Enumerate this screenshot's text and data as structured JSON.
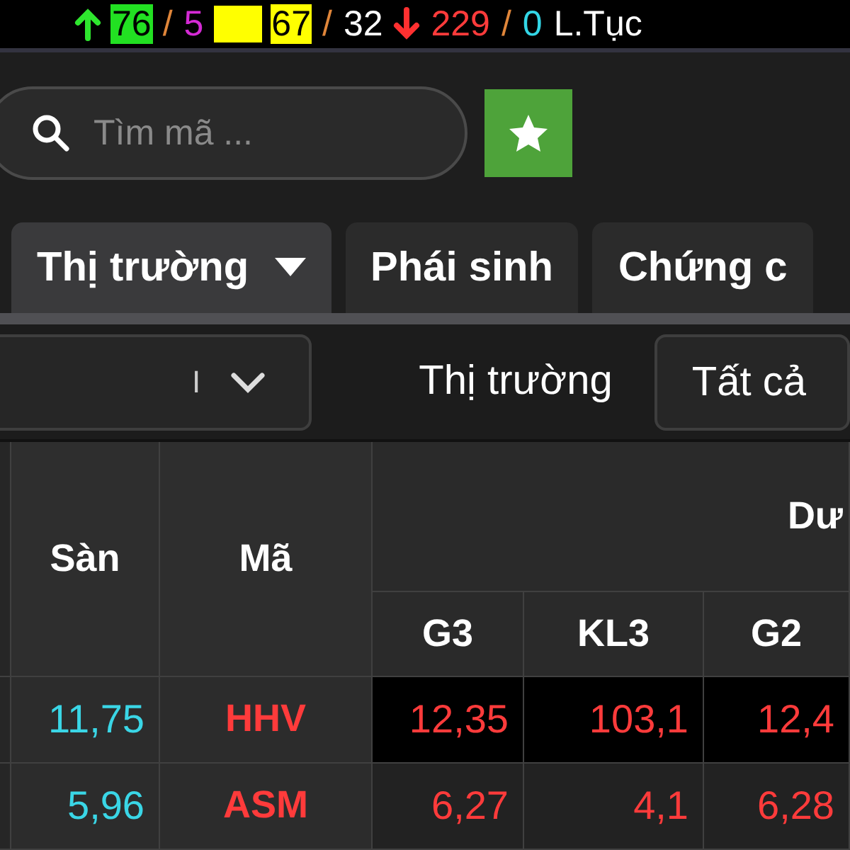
{
  "summary": [
    {
      "kind": "up",
      "color": "#2ee62e"
    },
    {
      "kind": "badge",
      "text": "76",
      "color": "#22e022"
    },
    {
      "kind": "sep",
      "text": "/",
      "color": "#e0863a"
    },
    {
      "kind": "count",
      "text": "5",
      "color": "#d42ad4"
    },
    {
      "kind": "box",
      "color": "#ffff00"
    },
    {
      "kind": "badge",
      "text": "67",
      "color": "#ffff00"
    },
    {
      "kind": "sep",
      "text": "/",
      "color": "#e0863a"
    },
    {
      "kind": "count",
      "text": "32",
      "color": "#ffffff"
    },
    {
      "kind": "down",
      "color": "#ff3030"
    },
    {
      "kind": "count",
      "text": "229",
      "color": "#ff3b3b"
    },
    {
      "kind": "sep",
      "text": "/",
      "color": "#e0863a"
    },
    {
      "kind": "count",
      "text": "0",
      "color": "#33d6e6"
    },
    {
      "kind": "count",
      "text": "L.Tục",
      "color": "#ffffff"
    }
  ],
  "search": {
    "placeholder": "Tìm mã ..."
  },
  "tabs": [
    {
      "label": "Thị trường",
      "selected": true,
      "dropdown": true
    },
    {
      "label": "Phái sinh",
      "selected": false,
      "dropdown": false
    },
    {
      "label": "Chứng c",
      "selected": false,
      "dropdown": false
    }
  ],
  "filters": {
    "dropdown_value": "I",
    "label": "Thị trường",
    "select_value": "Tất cả"
  },
  "table": {
    "columns": [
      "Sàn",
      "Mã"
    ],
    "group": "Dư",
    "subcolumns": [
      "G3",
      "KL3",
      "G2"
    ],
    "rows": [
      {
        "floor": "11,75",
        "code": "HHV",
        "color": "#ff3b3b",
        "cells": [
          "12,35",
          "103,1",
          "12,4"
        ],
        "highlight": true
      },
      {
        "floor": "5,96",
        "code": "ASM",
        "color": "#ff3b3b",
        "cells": [
          "6,27",
          "4,1",
          "6,28"
        ],
        "highlight": false
      }
    ]
  }
}
